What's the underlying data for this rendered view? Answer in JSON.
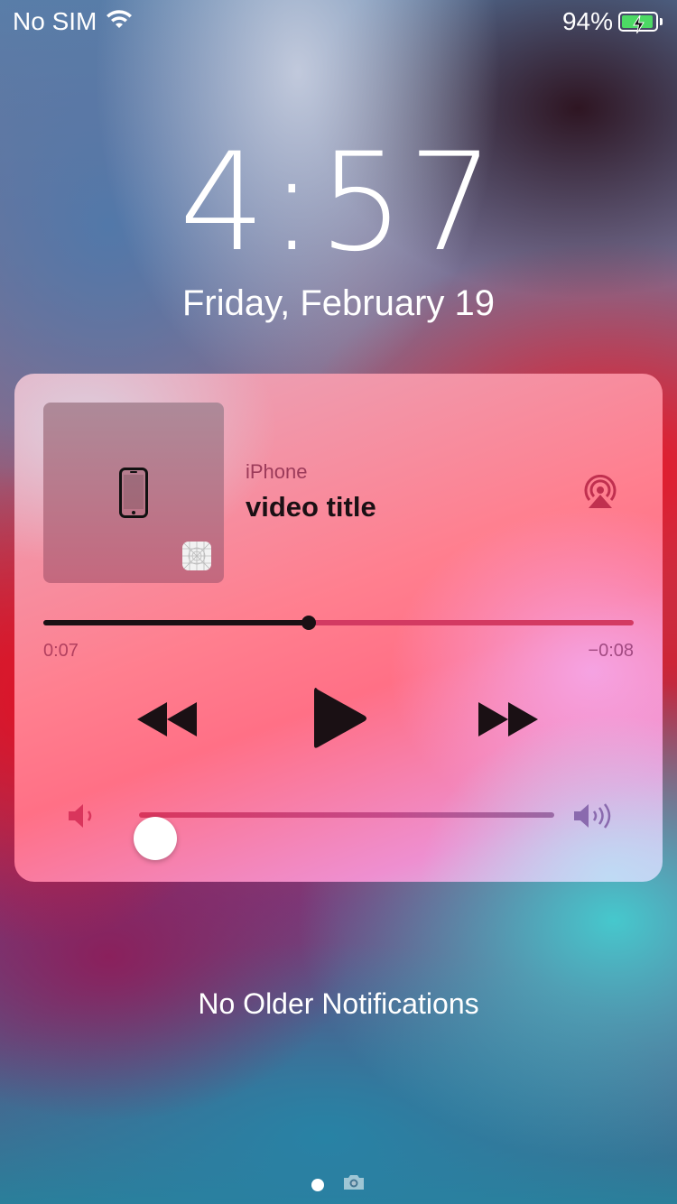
{
  "status_bar": {
    "carrier": "No SIM",
    "battery_percent": "94%",
    "battery_level": 0.94,
    "charging": true,
    "battery_color": "#4cd964"
  },
  "lock_screen": {
    "time": "4:57",
    "date": "Friday, February 19"
  },
  "now_playing": {
    "source": "iPhone",
    "title": "video title",
    "elapsed": "0:07",
    "remaining": "−0:08",
    "progress": 0.45,
    "volume": 0.04,
    "artwork_icon": "iphone-icon",
    "controls": {
      "rewind_icon": "rewind-icon",
      "play_icon": "play-icon",
      "forward_icon": "fast-forward-icon",
      "airplay_icon": "airplay-icon"
    },
    "accent_color": "#d33a62"
  },
  "notifications": {
    "empty_text": "No Older Notifications"
  },
  "page_indicator": {
    "icons": [
      "dot",
      "camera-icon"
    ]
  }
}
